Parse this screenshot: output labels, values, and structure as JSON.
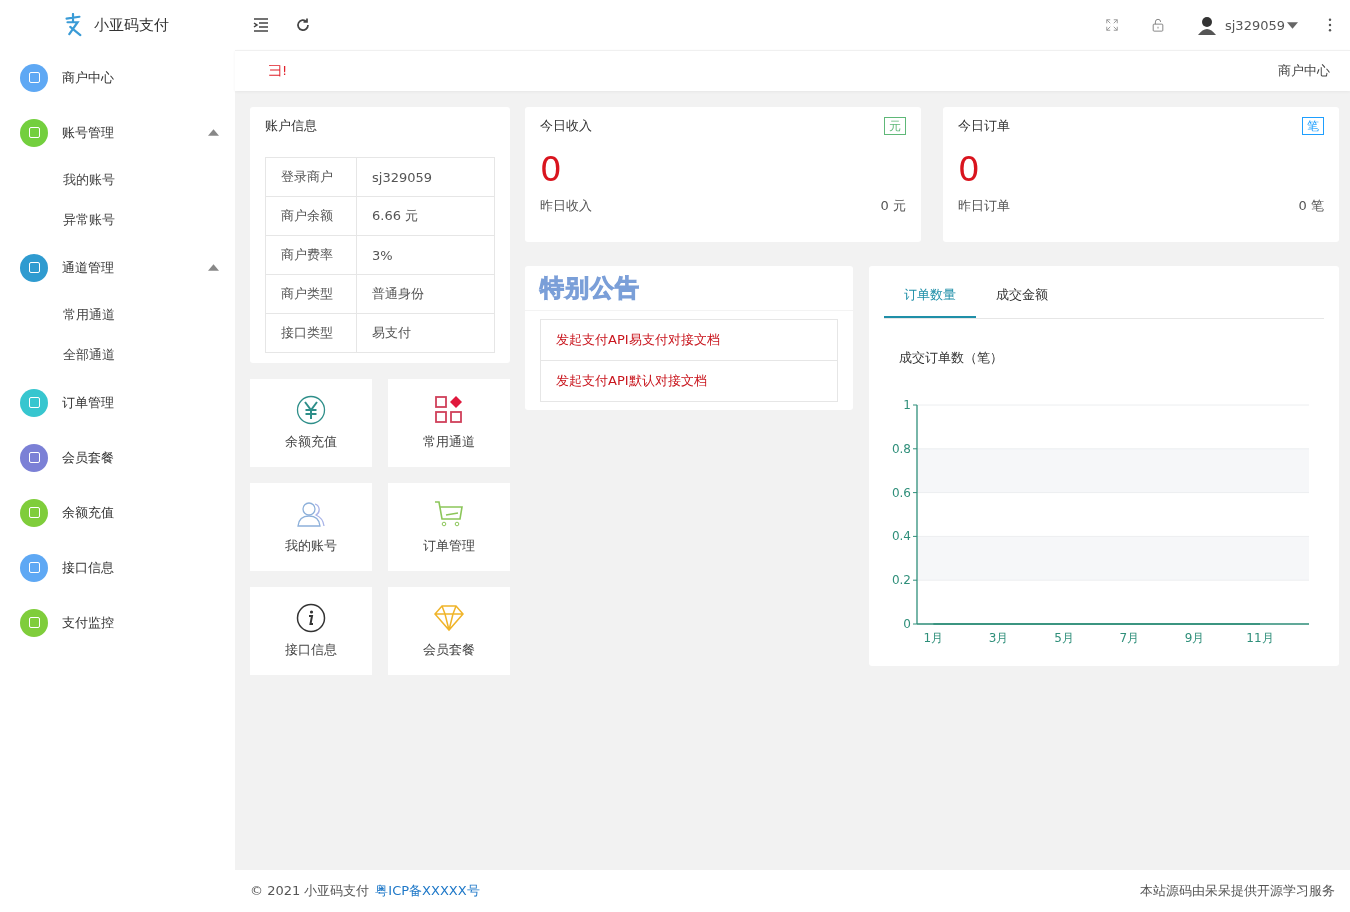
{
  "brand": {
    "name": "小亚码支付"
  },
  "sidebar": {
    "items": [
      {
        "label": "商户中心",
        "color": "#5ea8f4"
      },
      {
        "label": "账号管理",
        "color": "#73cf3e",
        "expanded": true,
        "children": [
          {
            "label": "我的账号"
          },
          {
            "label": "异常账号"
          }
        ]
      },
      {
        "label": "通道管理",
        "color": "#2f9bd0",
        "expanded": true,
        "children": [
          {
            "label": "常用通道"
          },
          {
            "label": "全部通道"
          }
        ]
      },
      {
        "label": "订单管理",
        "color": "#37c6cf"
      },
      {
        "label": "会员套餐",
        "color": "#7b80d6"
      },
      {
        "label": "余额充值",
        "color": "#7fcd3b"
      },
      {
        "label": "接口信息",
        "color": "#5ea8f4"
      },
      {
        "label": "支付监控",
        "color": "#7fcd3b"
      }
    ]
  },
  "header": {
    "user": "sj329059"
  },
  "marquee": "彐!",
  "breadcrumb": "商户中心",
  "account": {
    "title": "账户信息",
    "rows": [
      {
        "label": "登录商户",
        "value": "sj329059"
      },
      {
        "label": "商户余额",
        "value": "6.66 元"
      },
      {
        "label": "商户费率",
        "value": "3%"
      },
      {
        "label": "商户类型",
        "value": "普通身份"
      },
      {
        "label": "接口类型",
        "value": "易支付"
      }
    ]
  },
  "stats": [
    {
      "title": "今日收入",
      "badge": "元",
      "color": "#5fb878",
      "value": "0",
      "sub_label": "昨日收入",
      "sub_value": "0 元"
    },
    {
      "title": "今日订单",
      "badge": "笔",
      "color": "#1e9fff",
      "value": "0",
      "sub_label": "昨日订单",
      "sub_value": "0 笔"
    }
  ],
  "shortcuts": [
    {
      "label": "余额充值",
      "kind": "yen"
    },
    {
      "label": "常用通道",
      "kind": "apps"
    },
    {
      "label": "我的账号",
      "kind": "users"
    },
    {
      "label": "订单管理",
      "kind": "cart"
    },
    {
      "label": "接口信息",
      "kind": "info"
    },
    {
      "label": "会员套餐",
      "kind": "diamond"
    }
  ],
  "notice": {
    "title": "特别公告",
    "links": [
      "发起支付API易支付对接文档",
      "发起支付API默认对接文档"
    ]
  },
  "chart_panel": {
    "tabs": [
      {
        "label": "订单数量",
        "selected": true
      },
      {
        "label": "成交金额",
        "selected": false
      }
    ],
    "chart_data": {
      "type": "line",
      "title": "成交订单数（笔）",
      "categories": [
        "1月",
        "3月",
        "5月",
        "7月",
        "9月",
        "11月"
      ],
      "series": [
        {
          "color": "#2f8f7a",
          "values": [
            0,
            0,
            0,
            0,
            0,
            0
          ]
        }
      ],
      "grid": true,
      "ylim": [
        0,
        1
      ],
      "yticks": [
        0,
        0.2,
        0.4,
        0.6,
        0.8,
        1
      ]
    }
  },
  "footer": {
    "copyright": "© 2021 小亚码支付",
    "icp": "粤ICP备XXXXX号",
    "right": "本站源码由呆呆提供开源学习服务"
  }
}
